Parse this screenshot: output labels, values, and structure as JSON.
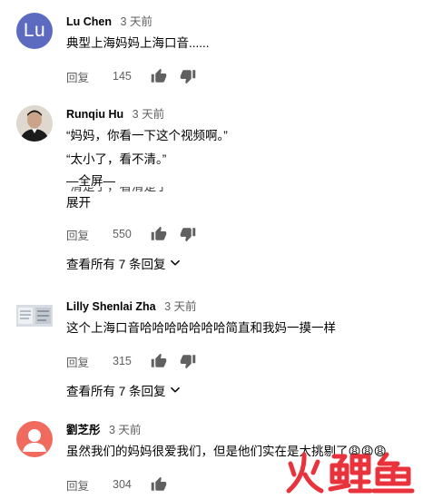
{
  "comments": [
    {
      "author": "Lu Chen",
      "time": "3 天前",
      "avatar_letter": "Lu",
      "lines": [
        "典型上海妈妈上海口音......"
      ],
      "reply_label": "回复",
      "likes": "145"
    },
    {
      "author": "Runqiu Hu",
      "time": "3 天前",
      "lines": [
        "“妈妈，你看一下这个视频啊。”",
        "“太小了，看不清。”",
        "—全屏—"
      ],
      "clipped_line": "“清楚了，看清楚了”",
      "expand_label": "展开",
      "reply_label": "回复",
      "likes": "550",
      "view_replies": "查看所有 7 条回复"
    },
    {
      "author": "Lilly Shenlai Zha",
      "time": "3 天前",
      "lines": [
        "这个上海口音哈哈哈哈哈哈哈简直和我妈一摸一样"
      ],
      "reply_label": "回复",
      "likes": "315",
      "view_replies": "查看所有 7 条回复"
    },
    {
      "author": "劉芝彤",
      "time": "3 天前",
      "lines": [
        "虽然我们的妈妈很爱我们，但是他们实在是太挑剔了😩😩😩"
      ],
      "reply_label": "回复",
      "likes": "304"
    }
  ],
  "watermark": "火鲤鱼",
  "colors": {
    "avatar_lu": "#5c6bc0",
    "avatar_default": "#f06a5d",
    "watermark": "#e8323c"
  }
}
